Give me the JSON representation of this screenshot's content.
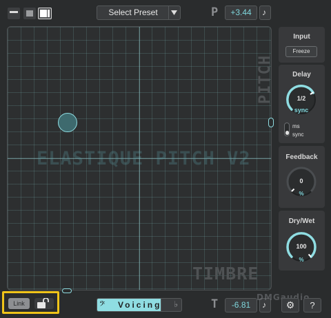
{
  "top_bar": {
    "preset_label": "Select Preset",
    "pitch_letter": "P",
    "pitch_value": "+3.44"
  },
  "pad": {
    "watermark": "ELASTIQUE PITCH V2",
    "y_label": "PITCH",
    "x_label": "TIMBRE"
  },
  "sidebar": {
    "input_title": "Input",
    "freeze_label": "Freeze",
    "delay_title": "Delay",
    "delay_value": "1/2",
    "delay_unit": "sync",
    "delay_mode_options": [
      "ms",
      "sync"
    ],
    "delay_mode_selected": "sync",
    "feedback_title": "Feedback",
    "feedback_value": "0",
    "feedback_unit": "%",
    "drywet_title": "Dry/Wet",
    "drywet_value": "100",
    "drywet_unit": "%"
  },
  "bottom_bar": {
    "link_label": "Link",
    "voicing_label": "Voicing",
    "timbre_letter": "T",
    "timbre_value": "-6.81",
    "settings_icon": "gear-icon",
    "help_label": "?",
    "logo_text": "DMGaudio"
  },
  "colors": {
    "accent": "#8fdde2",
    "highlight_border": "#f0c419",
    "background": "#2a2c2d"
  }
}
